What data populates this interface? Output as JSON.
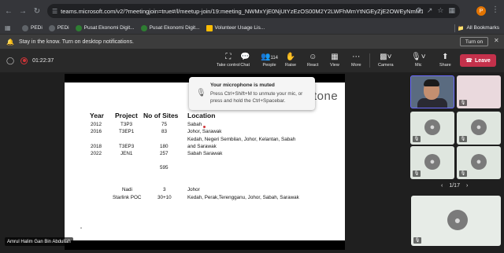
{
  "browser": {
    "url": "teams.microsoft.com/v2/?meetingjoin=true#/l/meetup-join/19:meeting_NWMxYjE0NjUtYzEzOS00M2Y2LWFhMmYtNGEyZjE2OWEyNmM1@thread.v...",
    "profile_initial": "P",
    "bookmarks": [
      "PEDi",
      "PEDi",
      "Pusat Ekonomi Digit...",
      "Pusat Ekonomi Digit...",
      "Volunteer Usage Lis..."
    ],
    "all_bookmarks": "All Bookmarks"
  },
  "notification": {
    "text": "Stay in the know. Turn on desktop notifications.",
    "turn_on": "Turn on"
  },
  "meeting": {
    "elapsed": "01:22:37",
    "toolbar": {
      "take_control": "Take control",
      "chat": "Chat",
      "people": "People",
      "people_count": "114",
      "raise": "Raise",
      "react": "React",
      "view": "View",
      "more": "More",
      "camera": "Camera",
      "mic": "Mic",
      "share": "Share",
      "leave": "Leave"
    },
    "toast": {
      "title": "Your microphone is muted",
      "body": "Press Ctrl+Shift+M to unmute your mic, or press and hold the Ctrl+Spacebar."
    },
    "presenter_name": "Amrul Halim Gan Bin Abdullah",
    "pager": "1/17"
  },
  "slide": {
    "logo_fragment": "tone",
    "headers": {
      "year": "Year",
      "project": "Project",
      "sites": "No of Sites",
      "location": "Location"
    },
    "rows": [
      {
        "year": "2012",
        "project": "T3P3",
        "sites": "75",
        "location": "Sabah"
      },
      {
        "year": "2016",
        "project": "T3EP1",
        "sites": "83",
        "location": "Johor, Sarawak"
      },
      {
        "year": "",
        "project": "",
        "sites": "",
        "location": "Kedah, Negeri Sembilan, Johor, Kelantan, Sabah"
      },
      {
        "year": "2018",
        "project": "T3EP3",
        "sites": "180",
        "location": "and Sarawak"
      },
      {
        "year": "2022",
        "project": "JEN1",
        "sites": "257",
        "location": "Sabah Sarawak"
      }
    ],
    "total": "595",
    "extra_rows": [
      {
        "project": "Nadi",
        "sites": "3",
        "location": "Johor"
      },
      {
        "project": "Starlink POC",
        "sites": "30+10",
        "location": "Kedah, Perak,Terengganu, Johor, Sabah, Sarawak"
      }
    ],
    "quote": "\""
  }
}
